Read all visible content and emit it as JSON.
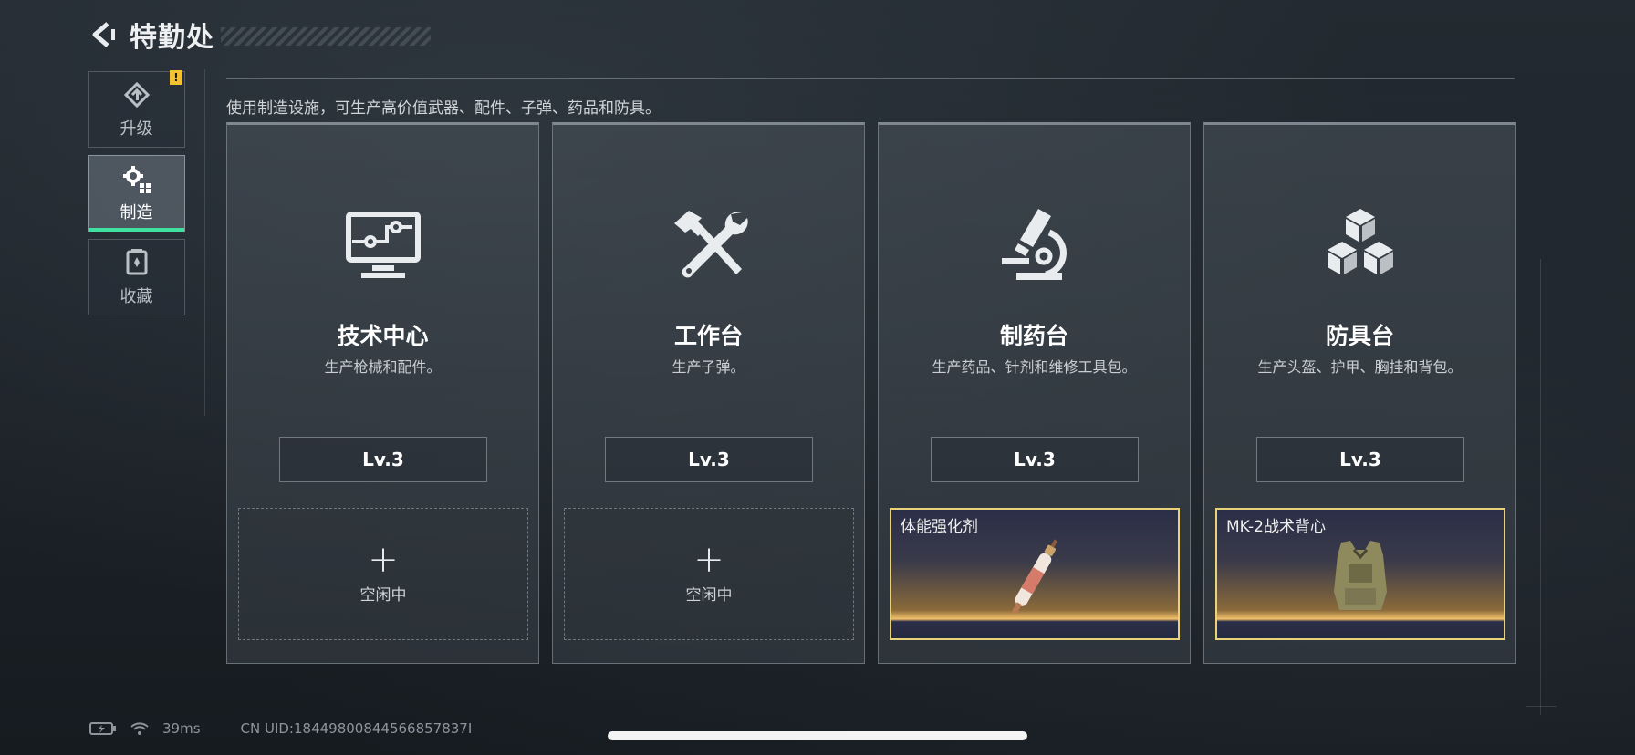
{
  "header": {
    "title": "特勤处",
    "back_icon": "back-arrow-icon"
  },
  "sidebar": {
    "items": [
      {
        "label": "升级",
        "icon": "upgrade-icon",
        "badge": "!",
        "active": false
      },
      {
        "label": "制造",
        "icon": "gears-icon",
        "active": true
      },
      {
        "label": "收藏",
        "icon": "collection-icon",
        "active": false
      }
    ]
  },
  "main": {
    "description": "使用制造设施，可生产高价值武器、配件、子弹、药品和防具。",
    "cards": [
      {
        "title": "技术中心",
        "subtitle": "生产枪械和配件。",
        "level": "Lv.3",
        "icon": "monitor-icon",
        "slot": {
          "state": "idle",
          "plus": "+",
          "label": "空闲中"
        }
      },
      {
        "title": "工作台",
        "subtitle": "生产子弹。",
        "level": "Lv.3",
        "icon": "hammer-wrench-icon",
        "slot": {
          "state": "idle",
          "plus": "+",
          "label": "空闲中"
        }
      },
      {
        "title": "制药台",
        "subtitle": "生产药品、针剂和维修工具包。",
        "level": "Lv.3",
        "icon": "microscope-icon",
        "slot": {
          "state": "item",
          "label": "体能强化剂",
          "item_icon": "syringe-icon"
        }
      },
      {
        "title": "防具台",
        "subtitle": "生产头盔、护甲、胸挂和背包。",
        "level": "Lv.3",
        "icon": "cubes-icon",
        "slot": {
          "state": "item",
          "label": "MK-2战术背心",
          "item_icon": "vest-icon"
        }
      }
    ]
  },
  "status_bar": {
    "ping": "39ms",
    "uid": "CN UID:18449800844566857837I"
  },
  "colors": {
    "accent_green": "#3fe0a0",
    "badge_yellow": "#f2c230",
    "item_border": "#e9d27a"
  }
}
